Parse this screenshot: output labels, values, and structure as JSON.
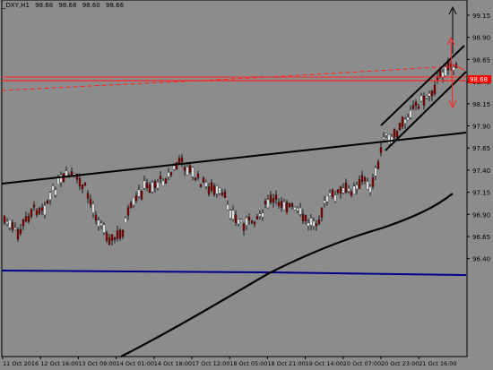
{
  "header": {
    "symbol": "_DXY,H1",
    "ohlc": [
      "98.68",
      "98.68",
      "98.60",
      "98.66"
    ]
  },
  "price_axis": {
    "labels": [
      "99.15",
      "98.90",
      "98.65",
      "98.40",
      "98.15",
      "97.90",
      "97.65",
      "97.40",
      "97.15",
      "96.90",
      "96.65",
      "96.40"
    ],
    "current_price": "98.68",
    "current_price_tag_color": "#ff0000"
  },
  "time_axis": {
    "labels": [
      "11 Oct 2016",
      "12 Oct 16:00",
      "13 Oct 09:00",
      "14 Oct 01:00",
      "14 Oct 18:00",
      "17 Oct 12:00",
      "18 Oct 05:00",
      "18 Oct 21:00",
      "19 Oct 14:00",
      "20 Oct 07:00",
      "20 Oct 23:00",
      "21 Oct 16:00"
    ]
  },
  "colors": {
    "background": "#8c8c8c",
    "bull_candle": "#ffffff",
    "bear_candle": "#8b0000",
    "trendline": "#000000",
    "support_line": "#00008b",
    "resistance_line": "#ff2222",
    "moving_average": "#000000"
  },
  "icons": {
    "up_arrow": "arrow-up-icon",
    "down_arrow": "arrow-down-icon"
  }
}
